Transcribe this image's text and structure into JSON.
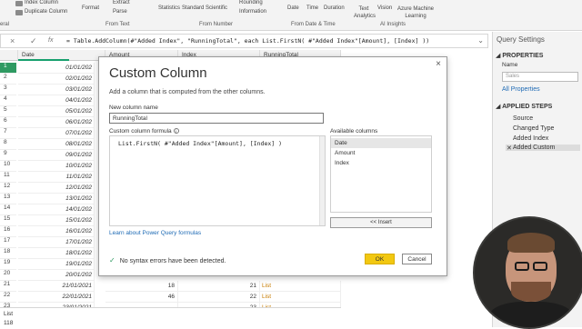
{
  "ribbon": {
    "items": [
      {
        "label": "Index Column",
        "key": "index_column"
      },
      {
        "label": "Duplicate Column",
        "key": "duplicate_column"
      },
      {
        "label": "Format",
        "key": "format"
      },
      {
        "label": "Extract",
        "key": "extract"
      },
      {
        "label": "Parse",
        "key": "parse"
      },
      {
        "label": "Statistics",
        "key": "statistics"
      },
      {
        "label": "Standard",
        "key": "standard"
      },
      {
        "label": "Scientific",
        "key": "scientific"
      },
      {
        "label": "Rounding",
        "key": "rounding"
      },
      {
        "label": "Information",
        "key": "information"
      },
      {
        "label": "Date",
        "key": "date"
      },
      {
        "label": "Time",
        "key": "time"
      },
      {
        "label": "Duration",
        "key": "duration"
      },
      {
        "label": "Text Analytics",
        "key": "text_analytics"
      },
      {
        "label": "Vision",
        "key": "vision"
      },
      {
        "label": "Azure Machine Learning",
        "key": "azure_ml"
      }
    ],
    "groups": [
      "eral",
      "From Text",
      "From Number",
      "From Date & Time",
      "AI Insights"
    ]
  },
  "formula_bar": {
    "text": "= Table.AddColumn(#\"Added Index\", \"RunningTotal\", each List.FirstN( #\"Added Index\"[Amount], [Index] ))",
    "cancel_icon": "×",
    "confirm_icon": "✓",
    "fx_icon": "fx"
  },
  "grid": {
    "headers": {
      "date": "Date",
      "amount": "Amount",
      "index": "Index",
      "running": "RunningTotal"
    },
    "rows": [
      {
        "n": "1",
        "date": "01/01/202"
      },
      {
        "n": "2",
        "date": "02/01/202"
      },
      {
        "n": "3",
        "date": "03/01/202"
      },
      {
        "n": "4",
        "date": "04/01/202"
      },
      {
        "n": "5",
        "date": "05/01/202"
      },
      {
        "n": "6",
        "date": "06/01/202"
      },
      {
        "n": "7",
        "date": "07/01/202"
      },
      {
        "n": "8",
        "date": "08/01/202"
      },
      {
        "n": "9",
        "date": "09/01/202"
      },
      {
        "n": "10",
        "date": "10/01/202"
      },
      {
        "n": "11",
        "date": "11/01/202"
      },
      {
        "n": "12",
        "date": "12/01/202"
      },
      {
        "n": "13",
        "date": "13/01/202"
      },
      {
        "n": "14",
        "date": "14/01/202"
      },
      {
        "n": "15",
        "date": "15/01/202"
      },
      {
        "n": "16",
        "date": "16/01/202"
      },
      {
        "n": "17",
        "date": "17/01/202"
      },
      {
        "n": "18",
        "date": "18/01/202"
      },
      {
        "n": "19",
        "date": "19/01/202"
      },
      {
        "n": "20",
        "date": "20/01/202"
      },
      {
        "n": "21",
        "date": "21/01/2021",
        "amount": "18",
        "index": "21",
        "running": "List"
      },
      {
        "n": "22",
        "date": "22/01/2021",
        "amount": "46",
        "index": "22",
        "running": "List"
      },
      {
        "n": "23",
        "date": "23/01/2021",
        "amount": "",
        "index": "23",
        "running": "List"
      }
    ]
  },
  "status": {
    "list_label": "List",
    "value": "118"
  },
  "dialog": {
    "title": "Custom Column",
    "subtitle": "Add a column that is computed from the other columns.",
    "name_label": "New column name",
    "name_value": "RunningTotal",
    "formula_label": "Custom column formula",
    "formula_value": "List.FirstN( #\"Added Index\"[Amount], [Index] )",
    "available_label": "Available columns",
    "available": [
      "Date",
      "Amount",
      "Index"
    ],
    "insert_label": "<< Insert",
    "learn_link": "Learn about Power Query formulas",
    "status_msg": "No syntax errors have been detected.",
    "ok_label": "OK",
    "cancel_label": "Cancel",
    "close_icon": "×"
  },
  "settings": {
    "header": "Query Settings",
    "properties_title": "PROPERTIES",
    "name_label": "Name",
    "name_value": "Sales",
    "all_properties": "All Properties",
    "applied_steps_title": "APPLIED STEPS",
    "steps": [
      "Source",
      "Changed Type",
      "Added Index",
      "Added Custom"
    ]
  },
  "colors": {
    "accent_green": "#2f9a62",
    "ok_yellow": "#f2c811",
    "link_blue": "#1f6bb5"
  }
}
